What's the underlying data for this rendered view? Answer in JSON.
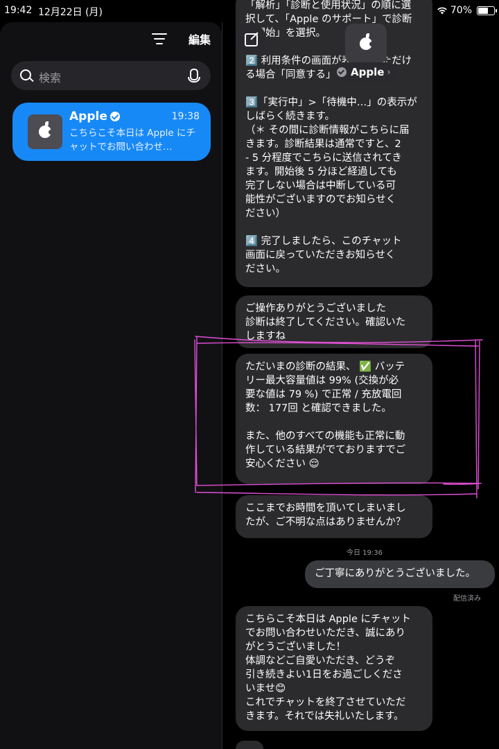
{
  "status_bar": {
    "time": "19:42",
    "date": "12月22日 (月)",
    "battery": "70%",
    "battery_level": 0.7
  },
  "sidebar": {
    "edit_label": "編集",
    "search_placeholder": "検索",
    "conversation": {
      "name": "Apple",
      "time": "19:38",
      "preview": "こちらこそ本日は Apple にチャットでお問い合わせ…"
    }
  },
  "header": {
    "contact_name": "Apple"
  },
  "messages": [
    {
      "dir": "in",
      "text": "「解析」「診断と使用状況」の順に選\n択して、「Apple のサポート」で診断\nを開始」を選択。\n\n2️⃣ 利用条件の画面が表示されただけ\nる場合「同意する」を選択\n\n3️⃣「実行中」>「待機中…」の表示が\nしばらく続きます。\n（＊ その間に診断情報がこちらに届\nきます。診断結果は通常ですと、2\n- 5 分程度でこちらに送信されてき\nます。開始後 5 分ほど経過しても\n完了しない場合は中断している可\n能性がございますのでお知らせく\nださい）\n\n4️⃣ 完了しましたら、このチャット\n画面に戻っていただきお知らせく\nださい。"
    },
    {
      "dir": "in",
      "text": "ご操作ありがとうございました\n診断は終了してください。確認いた\nしますね"
    },
    {
      "dir": "in",
      "text": "ただいまの診断の結果、 ✅ バッテ\nリー最大容量値は 99% (交換が必\n要な値は 79 %) で正常 / 充放電回\n数： 177回 と確認できました。\n\nまた、他のすべての機能も正常に動\n作している結果がでておりますでご\n安心ください 😌"
    },
    {
      "dir": "in",
      "text": "ここまでお時間を頂いてしまいまし\nたが、ご不明な点はありませんか？"
    },
    {
      "dir": "out",
      "text": "ご丁寧にありがとうございました。"
    },
    {
      "dir": "in",
      "text": "こちらこそ本日は Apple にチャット\nでお問い合わせいただき、誠にあり\nがとうございました！\n体調などご自愛いただき、どうぞ\n引き続きよい1日をお過ごしくださ\nいませ😊\nこれでチャットを終了させていただ\nきます。それでは失礼いたします。"
    }
  ],
  "timestamp_label": "今日 19:36",
  "delivered_label": "配信済み",
  "colors": {
    "accent": "#1789f7",
    "bubble_in": "#2b2b2e",
    "bubble_out": "#3a3b3e",
    "annotation": "#e24fd6"
  }
}
